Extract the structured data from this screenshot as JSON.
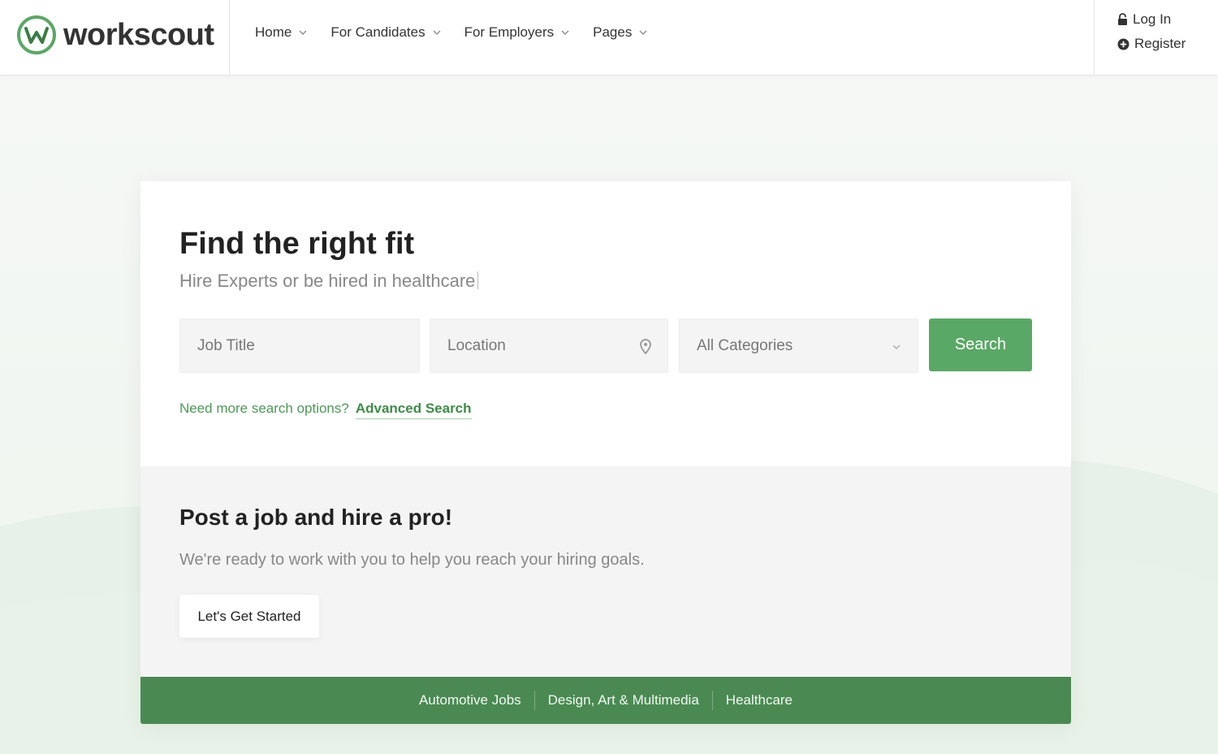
{
  "brand": {
    "name": "workscout",
    "accent": "#5aa865",
    "footer_bg": "#4a8a52"
  },
  "nav": {
    "items": [
      {
        "label": "Home"
      },
      {
        "label": "For Candidates"
      },
      {
        "label": "For Employers"
      },
      {
        "label": "Pages"
      }
    ]
  },
  "auth": {
    "login": "Log In",
    "register": "Register"
  },
  "hero": {
    "title": "Find the right fit",
    "subtitle": "Hire Experts or be hired in healthcare",
    "job_placeholder": "Job Title",
    "location_placeholder": "Location",
    "category_selected": "All Categories",
    "search_label": "Search",
    "more_options": "Need more search options?",
    "advanced_link": "Advanced Search"
  },
  "post": {
    "title": "Post a job and hire a pro!",
    "text": "We're ready to work with you to help you reach your hiring goals.",
    "button": "Let's Get Started"
  },
  "categories": [
    "Automotive Jobs",
    "Design, Art & Multimedia",
    "Healthcare"
  ]
}
